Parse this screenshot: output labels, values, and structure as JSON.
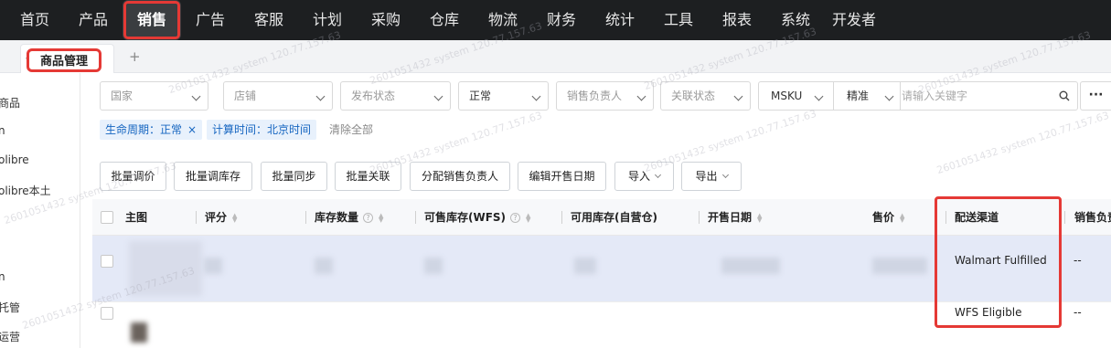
{
  "nav": {
    "items": [
      "首页",
      "产品",
      "销售",
      "广告",
      "客服",
      "计划",
      "采购",
      "仓库",
      "物流",
      "财务",
      "统计",
      "工具",
      "报表",
      "系统",
      "开发者"
    ],
    "active": "销售"
  },
  "tabs": {
    "active_label": "商品管理",
    "add_symbol": "+"
  },
  "sidebar": {
    "items": [
      "商品",
      "n",
      "olibre",
      "olibre本土",
      "n",
      "托管",
      "运营"
    ]
  },
  "filters": {
    "country": "国家",
    "store": "店铺",
    "publish_status": "发布状态",
    "status": "正常",
    "sales_owner": "销售负责人",
    "link_status": "关联状态",
    "search_field": "MSKU",
    "match_mode": "精准",
    "search_placeholder": "请输入关键字",
    "more": "···"
  },
  "chips": {
    "lifecycle": "生命周期：正常",
    "calc_time": "计算时间：北京时间",
    "clear_all": "清除全部",
    "remove_symbol": "×"
  },
  "toolbar": {
    "batch_price": "批量调价",
    "batch_stock": "批量调库存",
    "batch_sync": "批量同步",
    "batch_link": "批量关联",
    "assign_owner": "分配销售负责人",
    "edit_sale_date": "编辑开售日期",
    "import": "导入",
    "export": "导出"
  },
  "table": {
    "headers": {
      "image": "主图",
      "rating": "评分",
      "stock_qty": "库存数量",
      "sellable_wfs": "可售库存(WFS)",
      "available_self": "可用库存(自营仓)",
      "sale_date": "开售日期",
      "price": "售价",
      "fulfillment": "配送渠道",
      "sales_owner": "销售负责人"
    },
    "rows": [
      {
        "fulfillment": "Walmart Fulfilled",
        "sales_owner": "--"
      },
      {
        "fulfillment": "WFS Eligible",
        "sales_owner": "--"
      }
    ]
  },
  "watermark": "2601051432 system 120.77.157.63"
}
